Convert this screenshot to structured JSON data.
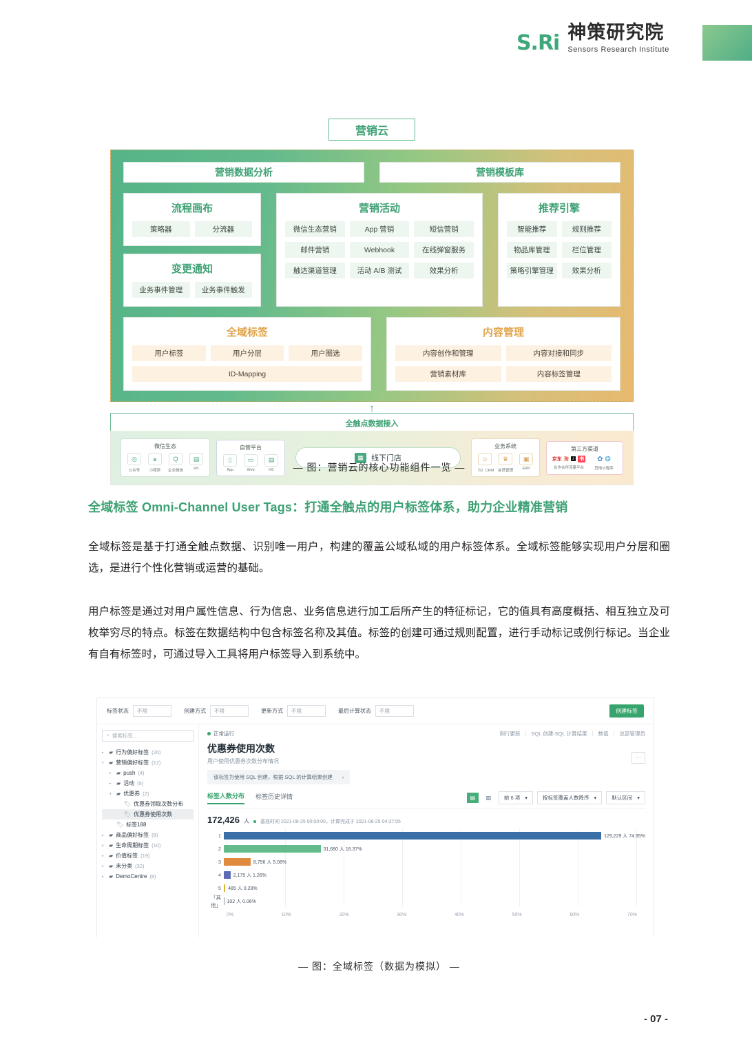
{
  "header": {
    "brand_mark": "S.Ri",
    "brand_cn": "神策研究院",
    "brand_en": "Sensors Research Institute"
  },
  "diagram": {
    "cloud_title": "营销云",
    "top_bars": [
      "营销数据分析",
      "营销模板库"
    ],
    "panels": [
      {
        "title": "流程画布",
        "chips": [
          [
            "策略器",
            "分流器"
          ]
        ]
      },
      {
        "title": "变更通知",
        "chips": [
          [
            "业务事件管理",
            "业务事件触发"
          ]
        ]
      },
      {
        "title": "营销活动",
        "chips": [
          [
            "微信生态营销",
            "App 营销",
            "短信营销"
          ],
          [
            "邮件营销",
            "Webhook",
            "在线弹窗服务"
          ],
          [
            "触达渠道管理",
            "活动 A/B 测试",
            "效果分析"
          ]
        ]
      },
      {
        "title": "推荐引擎",
        "chips": [
          [
            "智能推荐",
            "规则推荐"
          ],
          [
            "物品库管理",
            "栏位管理"
          ],
          [
            "策略引擎管理",
            "效果分析"
          ]
        ]
      }
    ],
    "tags_panel": {
      "title": "全域标签",
      "chips": [
        [
          "用户标签",
          "用户分层",
          "用户圈选"
        ],
        [
          "ID-Mapping"
        ]
      ]
    },
    "content_panel": {
      "title": "内容管理",
      "chips": [
        [
          "内容创作和管理",
          "内容对接和同步"
        ],
        [
          "营销素材库",
          "内容标签管理"
        ]
      ]
    },
    "access_label": "全触点数据接入",
    "sources": [
      {
        "title": "微信生态",
        "items": [
          {
            "icon": "official-account-icon",
            "label": "公众号"
          },
          {
            "icon": "mini-program-icon",
            "label": "小程序"
          },
          {
            "icon": "work-wechat-icon",
            "label": "企业微信"
          },
          {
            "icon": "h5-icon",
            "label": "H5"
          }
        ]
      },
      {
        "title": "自营平台",
        "items": [
          {
            "icon": "app-icon",
            "label": "App"
          },
          {
            "icon": "web-icon",
            "label": "Web"
          },
          {
            "icon": "h5-icon",
            "label": "H5"
          }
        ]
      },
      {
        "title": "业务系统",
        "items": [
          {
            "icon": "crm-icon",
            "label": "（S）CRM"
          },
          {
            "icon": "member-icon",
            "label": "会员管理"
          },
          {
            "icon": "erp-icon",
            "label": "ERP"
          }
        ]
      },
      {
        "title": "第三方渠道",
        "items": [
          {
            "icon": "partner-traffic-icon",
            "label": "合作伙伴流量平台"
          },
          {
            "icon": "other-mini-program-icon",
            "label": "其他小程序"
          }
        ]
      }
    ],
    "store_label": "线下门店",
    "caption": "— 图：营销云的核心功能组件一览 —"
  },
  "section": {
    "heading": "全域标签 Omni-Channel User Tags：打通全触点的用户标签体系，助力企业精准营销",
    "para1": "全域标签是基于打通全触点数据、识别唯一用户，构建的覆盖公域私域的用户标签体系。全域标签能够实现用户分层和圈选，是进行个性化营销或运营的基础。",
    "para2": "用户标签是通过对用户属性信息、行为信息、业务信息进行加工后所产生的特征标记，它的值具有高度概括、相互独立及可枚举穷尽的特点。标签在数据结构中包含标签名称及其值。标签的创建可通过规则配置，进行手动标记或例行标记。当企业有自有标签时，可通过导入工具将用户标签导入到系统中。"
  },
  "app": {
    "filters": [
      {
        "label": "标签状态",
        "value": "不限"
      },
      {
        "label": "创建方式",
        "value": "不限"
      },
      {
        "label": "更新方式",
        "value": "不限"
      },
      {
        "label": "最后计算状态",
        "value": "不限"
      }
    ],
    "create_button": "创建标签",
    "search_placeholder": "搜索标签...",
    "tree": [
      {
        "label": "行为偏好标签",
        "count": "(20)",
        "indent": 0,
        "caret": "▸",
        "type": "folder"
      },
      {
        "label": "营销偏好标签",
        "count": "(12)",
        "indent": 0,
        "caret": "▾",
        "type": "folder"
      },
      {
        "label": "push",
        "count": "(4)",
        "indent": 1,
        "caret": "▸",
        "type": "folder"
      },
      {
        "label": "活动",
        "count": "(5)",
        "indent": 1,
        "caret": "▸",
        "type": "folder"
      },
      {
        "label": "优惠券",
        "count": "(2)",
        "indent": 1,
        "caret": "▾",
        "type": "folder"
      },
      {
        "label": "优惠券领取次数分布",
        "count": "",
        "indent": 2,
        "caret": "",
        "type": "tag"
      },
      {
        "label": "优惠券使用次数",
        "count": "",
        "indent": 2,
        "caret": "",
        "type": "tag",
        "selected": true
      },
      {
        "label": "标签188",
        "count": "",
        "indent": 1,
        "caret": "",
        "type": "tag"
      },
      {
        "label": "商品偏好标签",
        "count": "(8)",
        "indent": 0,
        "caret": "▸",
        "type": "folder"
      },
      {
        "label": "生命周期标签",
        "count": "(10)",
        "indent": 0,
        "caret": "▸",
        "type": "folder"
      },
      {
        "label": "价值标签",
        "count": "(19)",
        "indent": 0,
        "caret": "▸",
        "type": "folder"
      },
      {
        "label": "未分类",
        "count": "(32)",
        "indent": 0,
        "caret": "▸",
        "type": "folder"
      },
      {
        "label": "DemoCentre",
        "count": "(8)",
        "indent": 0,
        "caret": "▸",
        "type": "folder"
      }
    ],
    "status": "正常运行",
    "meta_links": [
      "例行更新",
      "SQL 创建-SQL 计算结果",
      "数值",
      "总部管理员"
    ],
    "title": "优惠券使用次数",
    "subtitle": "用户使用优惠券次数分布情况",
    "sql_note": "该标签为使用 SQL 创建，根据 SQL 的计算结果创建",
    "more_icon": "ellipsis-icon",
    "tabs": [
      {
        "label": "标签人数分布",
        "active": true
      },
      {
        "label": "标签历史详情",
        "active": false
      }
    ],
    "tools": [
      {
        "type": "icon",
        "name": "bar-chart-icon",
        "glyph": "▤",
        "active": true
      },
      {
        "type": "icon",
        "name": "column-chart-icon",
        "glyph": "▥",
        "active": false
      },
      {
        "type": "select",
        "label": "前 6 项"
      },
      {
        "type": "select",
        "label": "按标签覆盖人数降序"
      },
      {
        "type": "select",
        "label": "默认区间"
      }
    ],
    "stat_number": "172,426",
    "stat_unit": "人",
    "stat_meta": "基准时间 2021-08-25 00:00:00，计算完成于 2021-08-25 04:37:05",
    "caption": "— 图：全域标签（数据为模拟） —"
  },
  "chart_data": {
    "type": "bar",
    "orientation": "horizontal",
    "title": "优惠券使用次数",
    "categories": [
      "1",
      "2",
      "3",
      "4",
      "5",
      "「其他」"
    ],
    "values": [
      74.95,
      18.37,
      5.08,
      1.26,
      0.28,
      0.06
    ],
    "counts": [
      129229,
      31680,
      8756,
      2175,
      485,
      102
    ],
    "labels": [
      "129,229 人 74.95%",
      "31,680 人 18.37%",
      "8,756 人 5.08%",
      "2,175 人 1.26%",
      "485 人 0.28%",
      "102 人 0.06%"
    ],
    "colors": [
      "#3b6fa8",
      "#63bb8c",
      "#e08a40",
      "#5b6bb5",
      "#dbb33b",
      "#8a97a4"
    ],
    "xlabel": "",
    "ylabel": "",
    "xlim": [
      0,
      80
    ],
    "xticks": [
      "0%",
      "10%",
      "20%",
      "30%",
      "40%",
      "50%",
      "60%",
      "70%"
    ],
    "grid": true,
    "legend": "none",
    "total": "172,426人"
  },
  "footer": {
    "page": "- 07 -"
  }
}
